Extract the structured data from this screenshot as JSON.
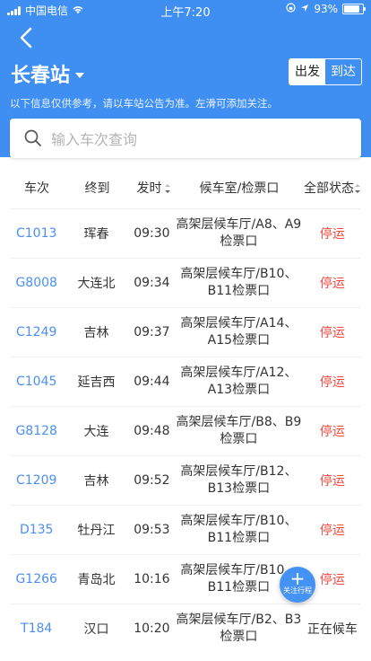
{
  "status_bar": {
    "carrier": "中国电信",
    "time": "上午7:20",
    "battery": "93%"
  },
  "header": {
    "station": "长春站",
    "tabs": {
      "depart": "出发",
      "arrive": "到达"
    },
    "notice": "以下信息仅供参考，请以车站公告为准。左滑可添加关注。"
  },
  "search": {
    "placeholder": "输入车次查询"
  },
  "table": {
    "headers": [
      "车次",
      "终到",
      "发时",
      "候车室/检票口",
      "全部状态"
    ],
    "rows": [
      {
        "train": "C1013",
        "dest": "珲春",
        "time": "09:30",
        "gate": "高架层候车厅/A8、A9检票口",
        "status": "停运"
      },
      {
        "train": "G8008",
        "dest": "大连北",
        "time": "09:34",
        "gate": "高架层候车厅/B10、B11检票口",
        "status": "停运"
      },
      {
        "train": "C1249",
        "dest": "吉林",
        "time": "09:37",
        "gate": "高架层候车厅/A14、A15检票口",
        "status": "停运"
      },
      {
        "train": "C1045",
        "dest": "延吉西",
        "time": "09:44",
        "gate": "高架层候车厅/A12、A13检票口",
        "status": "停运"
      },
      {
        "train": "G8128",
        "dest": "大连",
        "time": "09:48",
        "gate": "高架层候车厅/B8、B9检票口",
        "status": "停运"
      },
      {
        "train": "C1209",
        "dest": "吉林",
        "time": "09:52",
        "gate": "高架层候车厅/B12、B13检票口",
        "status": "停运"
      },
      {
        "train": "D135",
        "dest": "牡丹江",
        "time": "09:53",
        "gate": "高架层候车厅/B10、B11检票口",
        "status": "停运"
      },
      {
        "train": "G1266",
        "dest": "青岛北",
        "time": "10:16",
        "gate": "高架层候车厅/B10、B11检票口",
        "status": "停运"
      },
      {
        "train": "T184",
        "dest": "汉口",
        "time": "10:20",
        "gate": "高架层候车厅/B2、B3检票口",
        "status": "正在候车"
      }
    ]
  },
  "fab": {
    "label": "关注行程"
  },
  "colors": {
    "accent": "#3f8ff3",
    "train_link": "#4a8ff2",
    "stopped": "#f2473f"
  }
}
